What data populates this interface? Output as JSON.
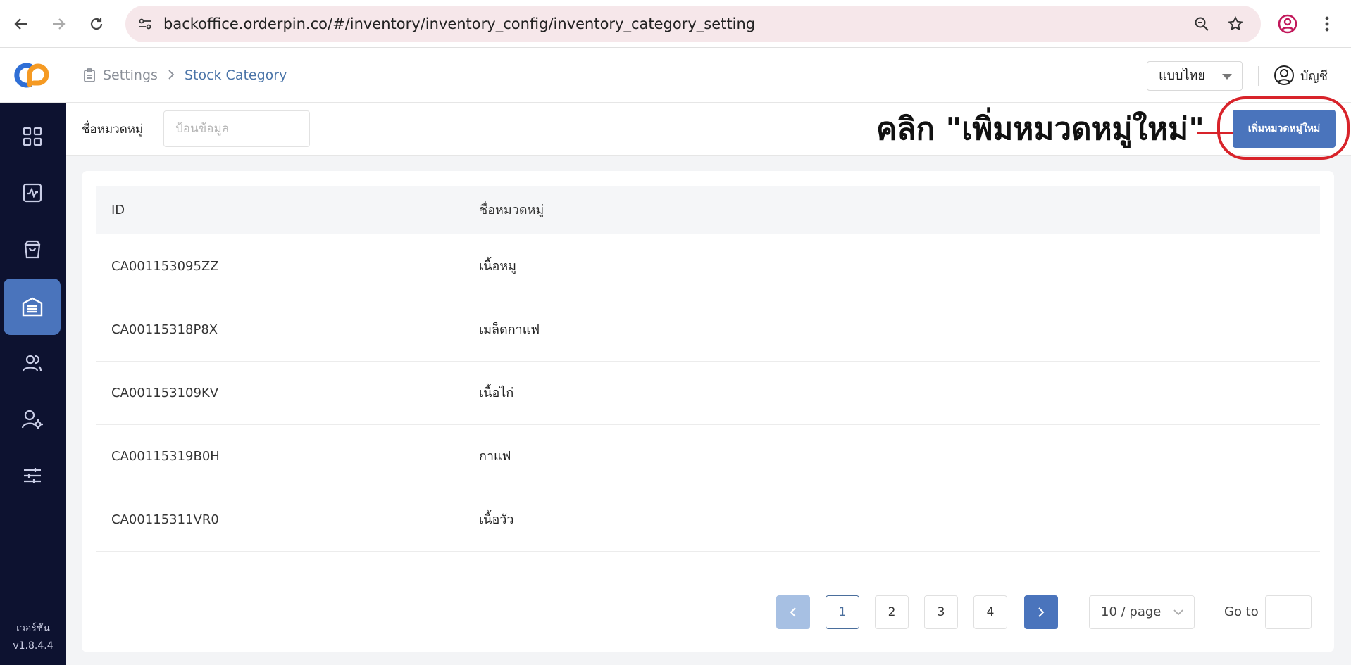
{
  "browser": {
    "url": "backoffice.orderpin.co/#/inventory/inventory_config/inventory_category_setting"
  },
  "sidebar": {
    "items": [
      {
        "icon": "dashboard-grid-icon",
        "active": false
      },
      {
        "icon": "activity-chart-icon",
        "active": false
      },
      {
        "icon": "shopping-bag-icon",
        "active": false
      },
      {
        "icon": "inventory-warehouse-icon",
        "active": true
      },
      {
        "icon": "users-icon",
        "active": false
      },
      {
        "icon": "user-settings-icon",
        "active": false
      },
      {
        "icon": "sliders-icon",
        "active": false
      }
    ],
    "version_label": "เวอร์ชัน",
    "version_number": "v1.8.4.4"
  },
  "header": {
    "breadcrumb": {
      "root": "Settings",
      "current": "Stock Category"
    },
    "language": "แบบไทย",
    "account_label": "บัญชี"
  },
  "filter": {
    "label": "ชื่อหมวดหมู่",
    "placeholder": "ป้อนข้อมูล",
    "value": ""
  },
  "annotation": {
    "text": "คลิก \"เพิ่มหมวดหมู่ใหม่\""
  },
  "add_button_label": "เพิ่มหมวดหมู่ใหม่",
  "colors": {
    "brand": "#4a74bc",
    "sidebar_bg": "#0d1230",
    "highlight": "#d8232a"
  },
  "table": {
    "columns": [
      "ID",
      "ชื่อหมวดหมู่"
    ],
    "rows": [
      {
        "id": "CA001153095ZZ",
        "name": "เนื้อหมู"
      },
      {
        "id": "CA00115318P8X",
        "name": "เมล็ดกาแฟ"
      },
      {
        "id": "CA001153109KV",
        "name": "เนื้อไก่"
      },
      {
        "id": "CA00115319B0H",
        "name": "กาแฟ"
      },
      {
        "id": "CA00115311VR0",
        "name": "เนื้อวัว"
      }
    ]
  },
  "pagination": {
    "pages": [
      "1",
      "2",
      "3",
      "4"
    ],
    "current_page": "1",
    "page_size": "10 / page",
    "goto_label": "Go to",
    "goto_value": ""
  }
}
